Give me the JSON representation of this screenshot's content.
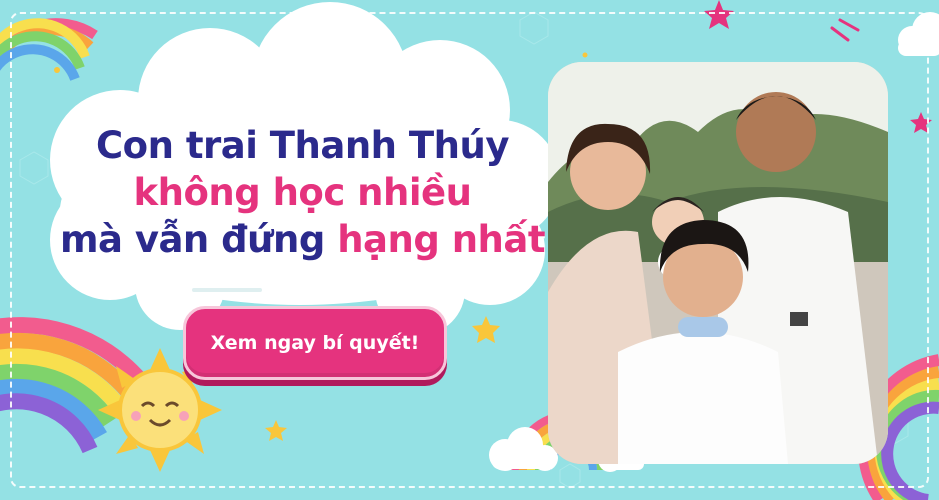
{
  "headline": {
    "line1": "Con trai Thanh Thúy",
    "line2": "không học nhiều",
    "line3_part1": "mà vẫn đứng ",
    "line3_part2": "hạng nhất"
  },
  "cta": {
    "label": "Xem ngay bí quyết!"
  },
  "colors": {
    "background": "#94e1e4",
    "navy_text": "#2b2a8c",
    "pink_accent": "#e5337e",
    "cloud": "#ffffff"
  },
  "icons": [
    "rainbow-icon",
    "sun-icon",
    "star-icon",
    "cloud-icon",
    "family-photo"
  ]
}
